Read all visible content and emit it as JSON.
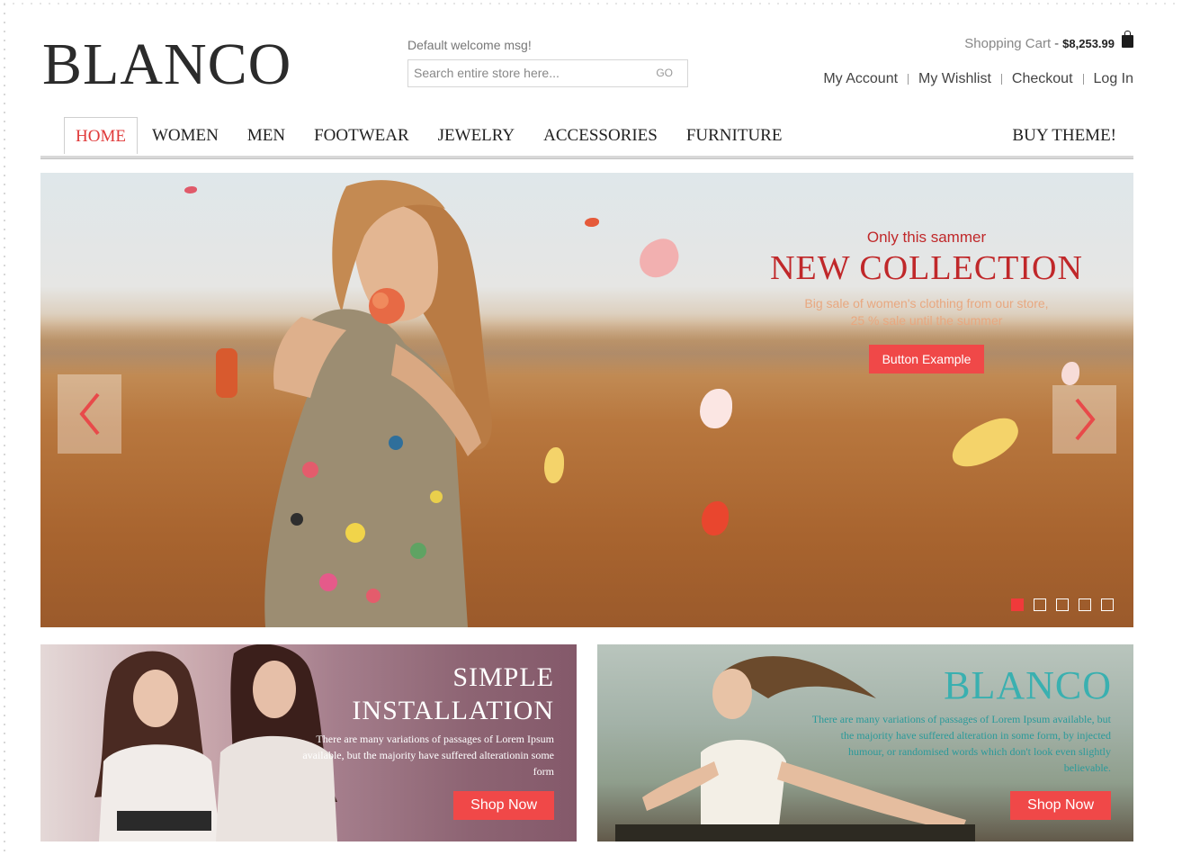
{
  "header": {
    "logo": "BLANCO",
    "welcome": "Default welcome msg!",
    "search": {
      "placeholder": "Search entire store here...",
      "go_label": "GO"
    },
    "cart": {
      "label": "Shopping Cart",
      "separator": "-",
      "amount": "$8,253.99",
      "icon": "shopping-bag-icon"
    },
    "links": [
      {
        "label": "My Account"
      },
      {
        "label": "My Wishlist"
      },
      {
        "label": "Checkout"
      },
      {
        "label": "Log In"
      }
    ]
  },
  "nav": {
    "items": [
      {
        "label": "HOME",
        "active": true
      },
      {
        "label": "WOMEN"
      },
      {
        "label": "MEN"
      },
      {
        "label": "FOOTWEAR"
      },
      {
        "label": "JEWELRY"
      },
      {
        "label": "ACCESSORIES"
      },
      {
        "label": "FURNITURE"
      }
    ],
    "buy_theme": "BUY THEME!"
  },
  "slider": {
    "pre_title": "Only this sammer",
    "title": "NEW COLLECTION",
    "desc_line1": "Big sale of women's clothing from our store,",
    "desc_line2": "25 % sale until the summer",
    "button": "Button Example",
    "prev_icon": "chevron-left-icon",
    "next_icon": "chevron-right-icon",
    "slide_count": 5,
    "active_slide": 1
  },
  "banners": [
    {
      "title_line1": "SIMPLE",
      "title_line2": "INSTALLATION",
      "text": "There are many variations of passages of Lorem Ipsum available, but the majority have suffered alterationin some form",
      "button": "Shop Now"
    },
    {
      "title": "BLANCO",
      "text": "There are many variations of passages of Lorem Ipsum available, but the majority have suffered alteration in some form, by injected humour, or randomised words which don't look even slightly believable.",
      "button": "Shop Now"
    }
  ],
  "colors": {
    "accent": "#f04848",
    "teal": "#3ab0b0",
    "headline_red": "#c0282a"
  }
}
